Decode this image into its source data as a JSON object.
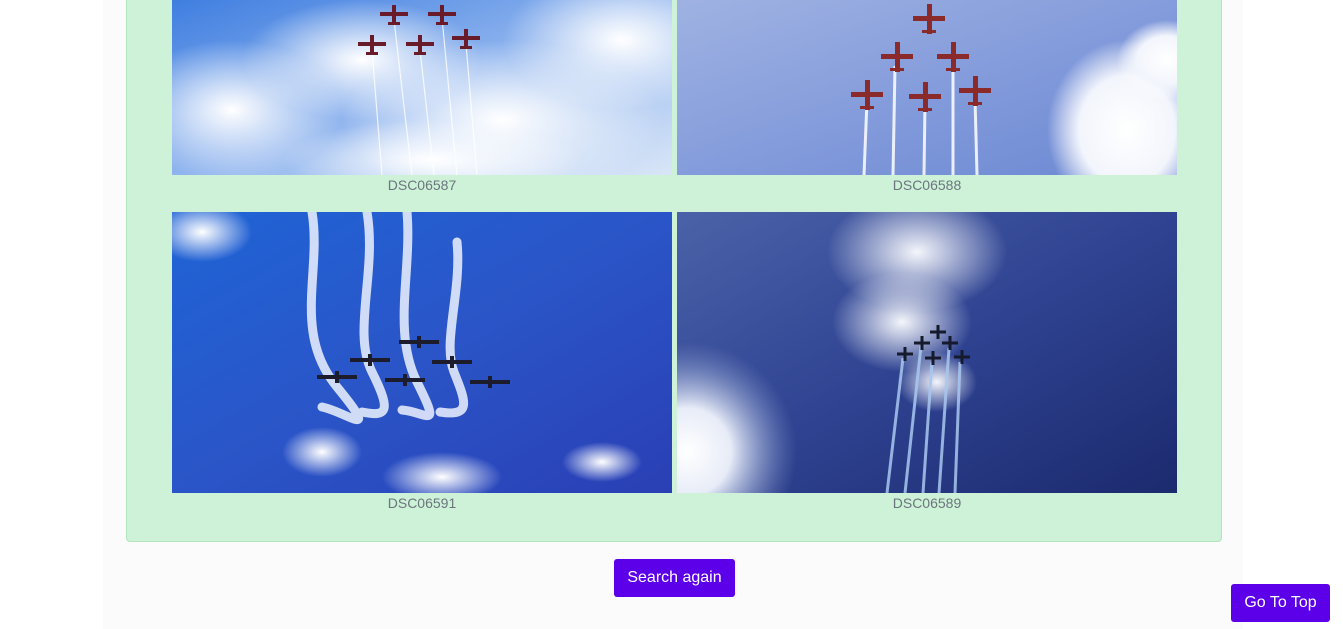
{
  "gallery": {
    "photos": [
      {
        "caption": "DSC06587",
        "scene": "white-smoke-airplanes-blue-sky"
      },
      {
        "caption": "DSC06588",
        "scene": "red-airplanes-formation-pale-sky"
      },
      {
        "caption": "DSC06591",
        "scene": "airplanes-smoke-loops-deep-blue-sky"
      },
      {
        "caption": "DSC06589",
        "scene": "airplanes-contrails-dark-sky-sun"
      }
    ]
  },
  "actions": {
    "search_again_label": "Search again",
    "go_to_top_label": "Go To Top"
  },
  "colors": {
    "panel_background": "#cdf2d8",
    "button_background": "#5b00e8",
    "caption_text": "#6c757d"
  }
}
